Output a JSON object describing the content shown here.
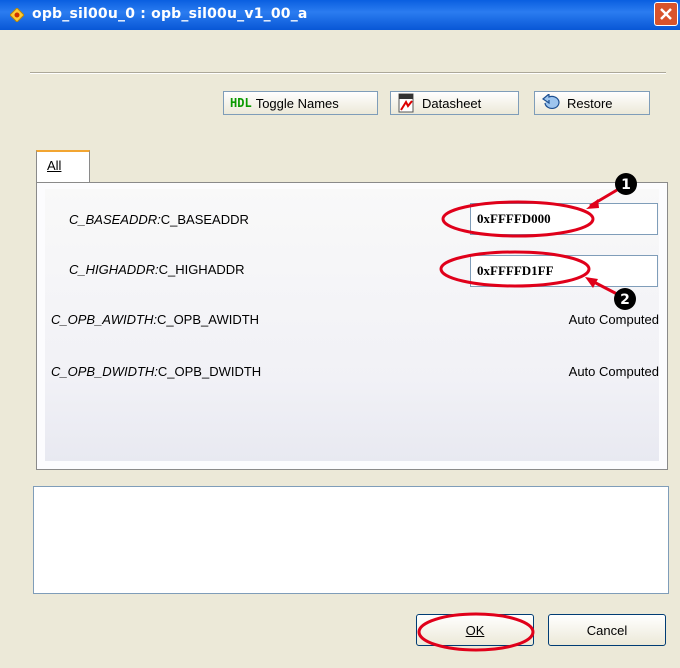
{
  "window": {
    "title": "opb_sil00u_0 : opb_sil00u_v1_00_a",
    "close_label": "×"
  },
  "toolbar": {
    "toggle_badge": "HDL",
    "toggle_label": "Toggle Names",
    "datasheet_label": "Datasheet",
    "restore_label": "Restore"
  },
  "tabs": [
    {
      "label": "All"
    }
  ],
  "params": [
    {
      "hdl_name": "C_BASEADDR:",
      "display_name": "C_BASEADDR",
      "value": "0xFFFFD000"
    },
    {
      "hdl_name": "C_HIGHADDR:",
      "display_name": "C_HIGHADDR",
      "value": "0xFFFFD1FF"
    },
    {
      "hdl_name": "C_OPB_AWIDTH:",
      "display_name": "C_OPB_AWIDTH",
      "value": "Auto Computed"
    },
    {
      "hdl_name": "C_OPB_DWIDTH:",
      "display_name": "C_OPB_DWIDTH",
      "value": "Auto Computed"
    }
  ],
  "annotations": {
    "marker1": "1",
    "marker2": "2",
    "color": "#e0001a"
  },
  "dialog": {
    "ok_label": "OK",
    "cancel_label": "Cancel"
  }
}
